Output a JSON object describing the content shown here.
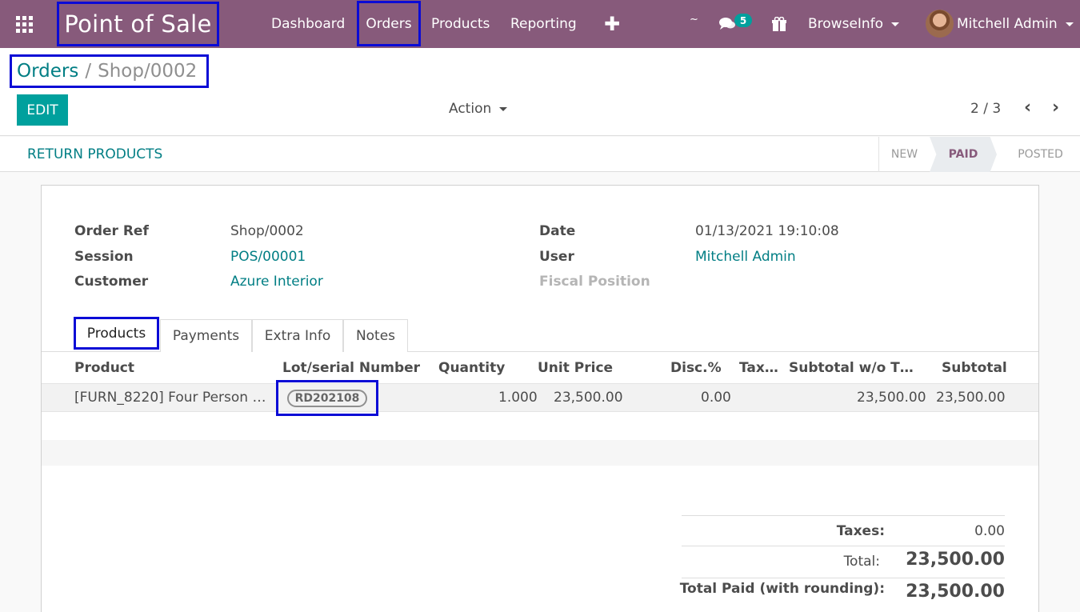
{
  "navbar": {
    "brand": "Point of Sale",
    "menu": [
      "Dashboard",
      "Orders",
      "Products",
      "Reporting"
    ],
    "plus": "✚",
    "tilde": "~",
    "chat_badge": "5",
    "company": "BrowseInfo",
    "user": "Mitchell Admin"
  },
  "breadcrumb": {
    "parent": "Orders",
    "separator": "/",
    "current": "Shop/0002"
  },
  "control": {
    "edit": "EDIT",
    "action": "Action",
    "pager": "2 / 3",
    "prev": "‹",
    "next": "›"
  },
  "statusbar": {
    "return": "RETURN PRODUCTS",
    "stages": [
      "NEW",
      "PAID",
      "POSTED"
    ],
    "active_stage": "PAID"
  },
  "form": {
    "order_ref_label": "Order Ref",
    "order_ref": "Shop/0002",
    "session_label": "Session",
    "session": "POS/00001",
    "customer_label": "Customer",
    "customer": "Azure Interior",
    "date_label": "Date",
    "date": "01/13/2021 19:10:08",
    "user_label": "User",
    "user": "Mitchell Admin",
    "fiscal_label": "Fiscal Position"
  },
  "tabs": [
    "Products",
    "Payments",
    "Extra Info",
    "Notes"
  ],
  "lines": {
    "headers": [
      "Product",
      "Lot/serial Number",
      "Quantity",
      "Unit Price",
      "Disc.%",
      "Tax…",
      "Subtotal w/o T…",
      "Subtotal"
    ],
    "rows": [
      {
        "product": "[FURN_8220] Four Person …",
        "lot": "RD202108",
        "quantity": "1.000",
        "unit_price": "23,500.00",
        "discount": "0.00",
        "tax": "",
        "subtotal_wo_tax": "23,500.00",
        "subtotal": "23,500.00"
      }
    ]
  },
  "totals": {
    "taxes_label": "Taxes:",
    "taxes": "0.00",
    "total_label": "Total:",
    "total": "23,500.00",
    "paid_label": "Total Paid (with rounding):",
    "paid": "23,500.00"
  },
  "colors": {
    "navbar": "#875a7b",
    "accent": "#00a09d",
    "link": "#017e84",
    "highlight": "#0b0bd6"
  }
}
